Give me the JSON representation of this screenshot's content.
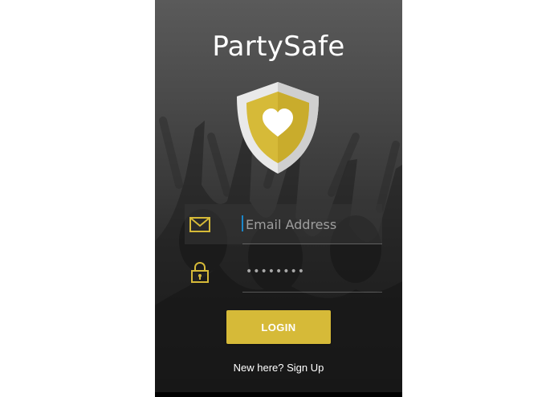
{
  "app": {
    "title": "PartySafe"
  },
  "logo": {
    "icon": "shield-heart-icon",
    "shield_color": "#e6e6e6",
    "inner_color": "#d6ba38",
    "heart_color": "#ffffff"
  },
  "form": {
    "email": {
      "icon": "envelope-icon",
      "placeholder": "Email Address",
      "value": ""
    },
    "password": {
      "icon": "padlock-icon",
      "value": "••••••••"
    },
    "login_label": "LOGIN",
    "signup_label": "New here? Sign Up"
  },
  "colors": {
    "accent": "#d6ba38",
    "caret": "#1b87c9",
    "text": "#ffffff"
  }
}
